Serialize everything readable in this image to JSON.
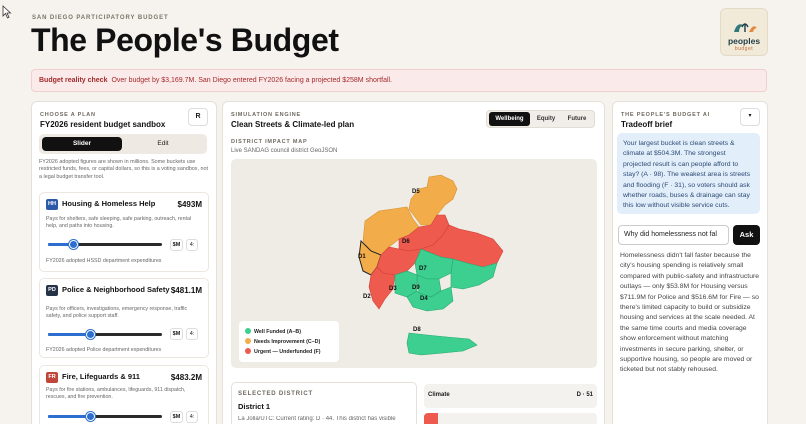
{
  "header": {
    "eyebrow": "SAN DIEGO PARTICIPATORY BUDGET",
    "title": "The People's Budget",
    "logo_line1": "peoples",
    "logo_line2": "budget"
  },
  "banner": {
    "label": "Budget reality check",
    "text": "Over budget by $3,169.7M. San Diego entered FY2026 facing a projected $258M shortfall."
  },
  "plan": {
    "label": "CHOOSE A PLAN",
    "title": "FY2026 resident budget sandbox",
    "reset": "R",
    "mode_slider": "Slider",
    "mode_edit": "Edit",
    "note": "FY2026 adopted figures are shown in millions. Some buckets use restricted funds, fees, or capital dollars, so this is a voting sandbox, not a legal budget transfer tool.",
    "buckets": [
      {
        "code": "HH",
        "color": "#2a5aa8",
        "name": "Housing & Homeless Help",
        "amount": "$493M",
        "desc": "Pays for shelters, safe sleeping, safe parking, outreach, rental help, and paths into housing.",
        "unit": "$M",
        "step": "4:",
        "level": 0.22,
        "source": "FY2026 adopted HSSD department expenditures"
      },
      {
        "code": "PD",
        "color": "#253349",
        "name": "Police & Neighborhood Safety",
        "amount": "$481.1M",
        "desc": "Pays for officers, investigations, emergency response, traffic safety, and police support staff.",
        "unit": "$M",
        "step": "4:",
        "level": 0.37,
        "source": "FY2026 adopted Police department expenditures"
      },
      {
        "code": "FR",
        "color": "#c0463c",
        "name": "Fire, Lifeguards & 911",
        "amount": "$483.2M",
        "desc": "Pays for fire stations, ambulances, lifeguards, 911 dispatch, rescues, and fire prevention.",
        "unit": "$M",
        "step": "4:",
        "level": 0.37,
        "source": ""
      }
    ]
  },
  "engine": {
    "label": "SIMULATION ENGINE",
    "title": "Clean Streets & Climate-led plan",
    "tabs": [
      "Wellbeing",
      "Equity",
      "Future"
    ],
    "map_label": "DISTRICT IMPACT MAP",
    "map_source": "Live SANDAG council district GeoJSON",
    "districts": [
      "D1",
      "D2",
      "D3",
      "D4",
      "D5",
      "D6",
      "D7",
      "D8",
      "D9"
    ],
    "legend": [
      {
        "label": "Well Funded (A–B)",
        "color": "#3dcf8f"
      },
      {
        "label": "Needs Improvement (C–D)",
        "color": "#f2ad4a"
      },
      {
        "label": "Urgent — Underfunded (F)",
        "color": "#ef5a4f"
      }
    ]
  },
  "selected": {
    "label": "SELECTED DISTRICT",
    "name": "District 1",
    "text": "La Jolla/UTC: Current rating: D · 44. This district has visible"
  },
  "metrics": [
    {
      "name": "Climate",
      "value": "D · 51"
    }
  ],
  "ai": {
    "label": "THE PEOPLE'S BUDGET AI",
    "title": "Tradeoff brief",
    "menu": "▾",
    "brief": "Your largest bucket is clean streets & climate at $504.3M. The strongest projected result is can people afford to stay? (A · 98). The weakest area is streets and flooding (F · 31), so voters should ask whether roads, buses & drainage can stay this low without visible service cuts.",
    "question": "Why did homelessness not fal",
    "ask": "Ask",
    "answer": "Homelessness didn't fall faster because the city's housing spending is relatively small compared with public-safety and infrastructure outlays — only $53.8M for Housing versus $711.9M for Police and $516.6M for Fire — so there's limited capacity to build or subsidize housing and services at the scale needed. At the same time courts and media coverage show enforcement without matching investments in secure parking, shelter, or supportive housing, so people are moved or ticketed but not stably rehoused."
  }
}
